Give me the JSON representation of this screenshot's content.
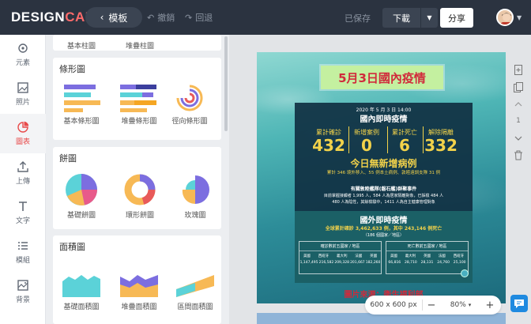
{
  "app": {
    "logo_a": "DESIGN",
    "logo_b": "CAP"
  },
  "topbar": {
    "templates_label": "模板",
    "undo_label": "撤銷",
    "redo_label": "回退",
    "saved_label": "已保存",
    "download_label": "下載",
    "share_label": "分享"
  },
  "nav": [
    {
      "id": "elements",
      "label": "元素",
      "icon": "grid-icon"
    },
    {
      "id": "photos",
      "label": "照片",
      "icon": "image-icon"
    },
    {
      "id": "charts",
      "label": "圖表",
      "icon": "pie-chart-icon",
      "active": true
    },
    {
      "id": "upload",
      "label": "上傳",
      "icon": "upload-icon"
    },
    {
      "id": "text",
      "label": "文字",
      "icon": "text-icon"
    },
    {
      "id": "module",
      "label": "模組",
      "icon": "list-icon"
    },
    {
      "id": "background",
      "label": "背景",
      "icon": "background-icon"
    }
  ],
  "panel": {
    "top_labels": [
      "基本柱圖",
      "堆疊柱圖"
    ],
    "sections": [
      {
        "title": "條形圖",
        "items": [
          "基本條形圖",
          "堆疊條形圖",
          "徑向條形圖"
        ]
      },
      {
        "title": "餅圖",
        "items": [
          "基礎餅圖",
          "環形餅圖",
          "玫瑰圖"
        ]
      },
      {
        "title": "面積圖",
        "items": [
          "基礎面積圖",
          "堆疊面積圖",
          "區間面積圖"
        ]
      }
    ]
  },
  "poster": {
    "title": "5月3日國內疫情",
    "date": "2020 年 5 月 3 日 14:00",
    "domestic_heading": "國內即時疫情",
    "stats": [
      {
        "label": "累計確診",
        "value": "432"
      },
      {
        "label": "新增案例",
        "value": "0"
      },
      {
        "label": "累計死亡",
        "value": "6"
      },
      {
        "label": "解除隔離",
        "value": "332"
      }
    ],
    "headline": "今日無新增病例",
    "subline": "累計 346 境外移入、55 例本土病例、敦睦遠訓支隊 31 例",
    "cluster_title": "有關敦睦艦隊(磐石艦)群聚事件",
    "cluster_line1": "目前掌握接觸者 1,995 人，584 人為居家隔離對象，已採檢 484 人",
    "cluster_line2": "480 人為陰性，其餘檢驗中，1411 人為自主健康管理對象",
    "intl_heading": "國外即時疫情",
    "intl_line": "全球累計確診 3,462,633 例，其中 243,146 例死亡",
    "intl_sub": "（186 個國家／地區）",
    "table_confirmed": {
      "title": "確診數前五國家 / 地區",
      "countries": [
        "美國",
        "西班牙",
        "義大利",
        "法國",
        "英國"
      ],
      "values": [
        "1,147,495",
        "216,582",
        "209,328",
        "201,667",
        "182,260"
      ]
    },
    "table_deaths": {
      "title": "死亡數前五國家 / 地區",
      "countries": [
        "美國",
        "義大利",
        "英國",
        "法國",
        "西班牙"
      ],
      "values": [
        "66,816",
        "28,710",
        "28,131",
        "24,760",
        "25,100"
      ]
    },
    "source": "圖片來源：衛生福利部"
  },
  "zoom": {
    "size_label": "600 x 600 px",
    "minus": "−",
    "value": "80%",
    "plus": "+"
  },
  "rail": {
    "page_number": "1"
  },
  "colors": {
    "topbar": "#2b3340",
    "accent": "#e84a4a",
    "brand_cap": "#ff6b6b"
  }
}
